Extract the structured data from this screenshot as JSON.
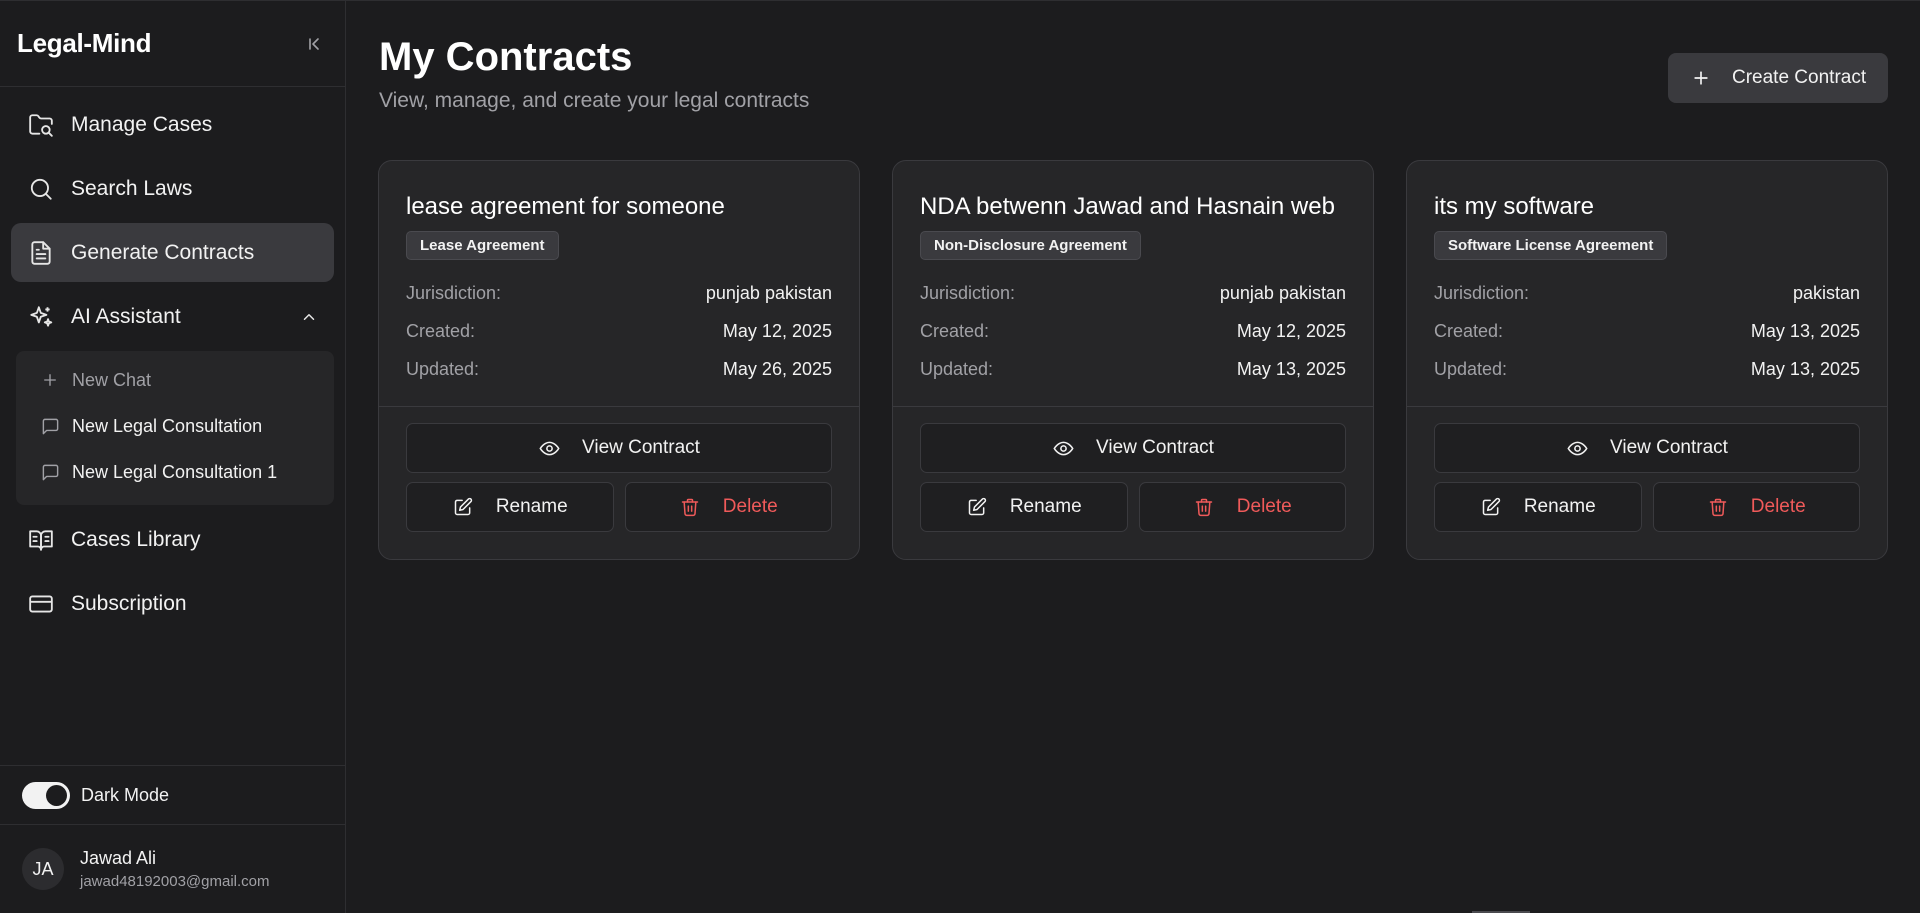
{
  "sidebar": {
    "app_title": "Legal-Mind",
    "nav": [
      {
        "label": "Manage Cases",
        "icon": "folder-search-icon"
      },
      {
        "label": "Search Laws",
        "icon": "search-icon"
      },
      {
        "label": "Generate Contracts",
        "icon": "file-text-icon",
        "active": true
      },
      {
        "label": "AI Assistant",
        "icon": "sparkles-icon",
        "expanded": true
      },
      {
        "label": "Cases Library",
        "icon": "book-open-icon"
      },
      {
        "label": "Subscription",
        "icon": "credit-card-icon"
      }
    ],
    "assistant_sub": [
      {
        "label": "New Chat",
        "icon": "plus-icon"
      },
      {
        "label": "New Legal Consultation",
        "icon": "message-square-icon"
      },
      {
        "label": "New Legal Consultation 1",
        "icon": "message-square-icon"
      }
    ],
    "dark_mode_label": "Dark Mode",
    "dark_mode_on": true,
    "user": {
      "initials": "JA",
      "name": "Jawad Ali",
      "email": "jawad48192003@gmail.com"
    }
  },
  "main": {
    "title": "My Contracts",
    "subtitle": "View, manage, and create your legal contracts",
    "create_label": "Create Contract",
    "labels": {
      "jurisdiction": "Jurisdiction:",
      "created": "Created:",
      "updated": "Updated:"
    },
    "actions": {
      "view": "View Contract",
      "rename": "Rename",
      "delete": "Delete"
    },
    "contracts": [
      {
        "title": "lease agreement for someone",
        "type": "Lease Agreement",
        "jurisdiction": "punjab pakistan",
        "created": "May 12, 2025",
        "updated": "May 26, 2025"
      },
      {
        "title": "NDA betwenn Jawad and Hasnain web",
        "type": "Non-Disclosure Agreement",
        "jurisdiction": "punjab pakistan",
        "created": "May 12, 2025",
        "updated": "May 13, 2025"
      },
      {
        "title": "its my software",
        "type": "Software License Agreement",
        "jurisdiction": "pakistan",
        "created": "May 13, 2025",
        "updated": "May 13, 2025"
      }
    ]
  },
  "colors": {
    "background": "#1c1c1e",
    "card": "#262628",
    "active_nav": "#3a3a3e",
    "danger": "#f05a5a"
  }
}
